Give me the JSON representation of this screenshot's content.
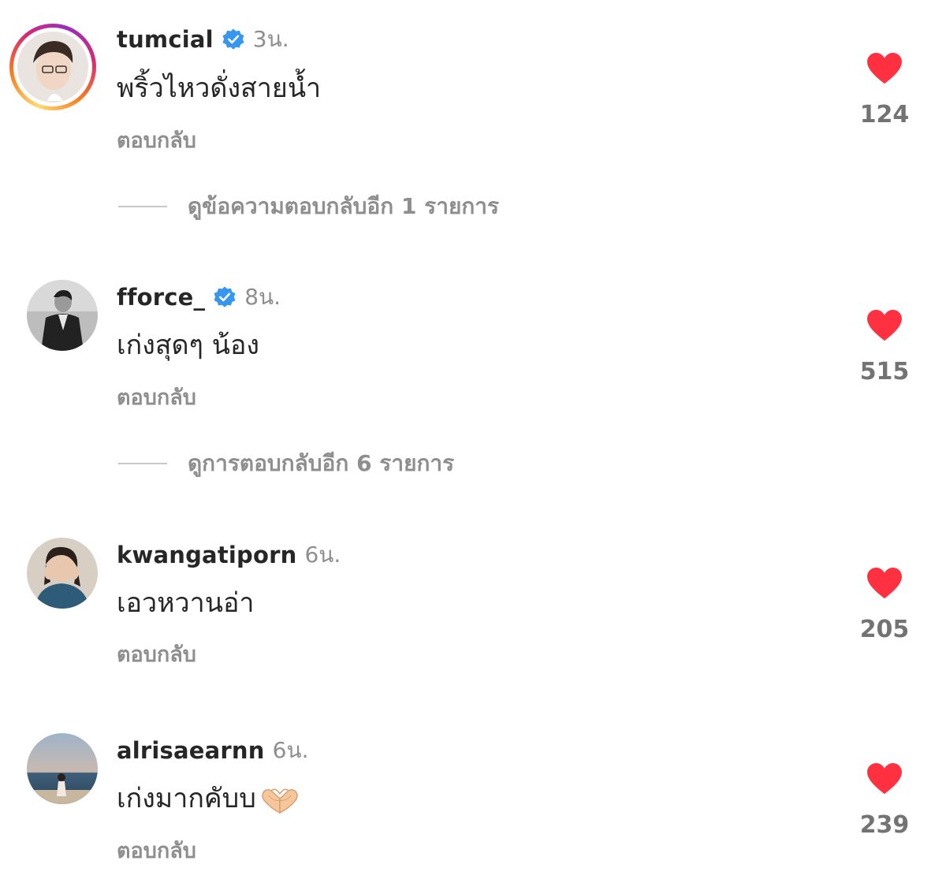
{
  "reply_label": "ตอบกลับ",
  "comments": [
    {
      "username": "tumcial",
      "verified": true,
      "time": "3น.",
      "text": "พริ้วไหวดั่งสายน้ำ",
      "likes": "124",
      "has_story": true,
      "more_replies": "ดูข้อความตอบกลับอีก 1 รายการ"
    },
    {
      "username": "fforce_",
      "verified": true,
      "time": "8น.",
      "text": "เก่งสุดๆ น้อง",
      "likes": "515",
      "has_story": false,
      "more_replies": "ดูการตอบกลับอีก 6 รายการ"
    },
    {
      "username": "kwangatiporn",
      "verified": false,
      "time": "6น.",
      "text": "เอวหวานอ่า",
      "likes": "205",
      "has_story": false
    },
    {
      "username": "alrisaearnn",
      "verified": false,
      "time": "6น.",
      "text": "เก่งมากคับบ",
      "text_emoji": "heart-hands-emoji",
      "likes": "239",
      "has_story": false
    }
  ],
  "colors": {
    "heart": "#ff3040",
    "verified": "#3797f0",
    "secondary_text": "#8e8e8e",
    "primary_text": "#262626"
  },
  "icons": {
    "like": "heart-icon",
    "verified": "verified-badge-icon"
  }
}
